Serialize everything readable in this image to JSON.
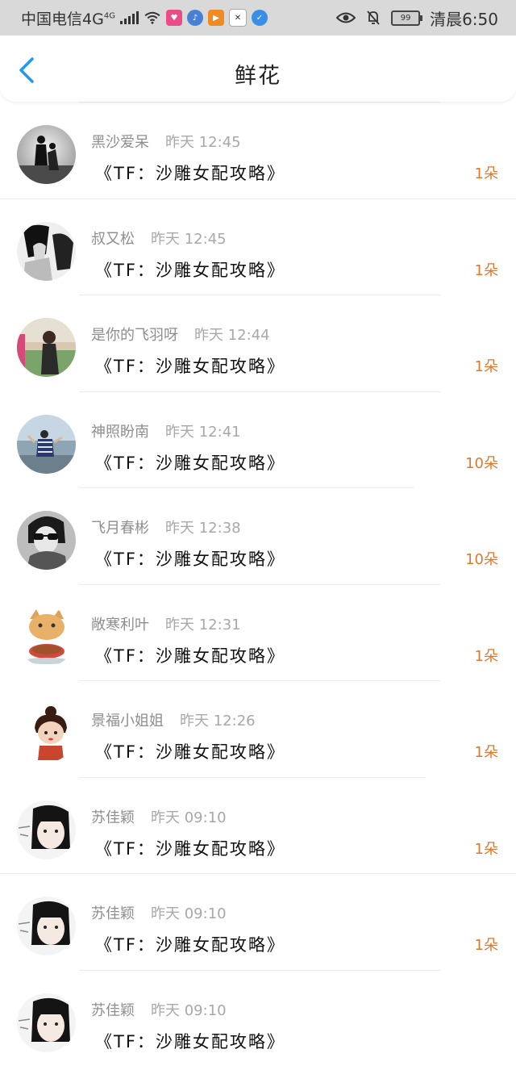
{
  "status_bar": {
    "carrier": "中国电信",
    "network": "4G",
    "network_sup": "4G",
    "battery": "99",
    "time": "清晨6:50",
    "icons": [
      "signal-icon",
      "wifi-icon",
      "app-icon-1",
      "music-app-icon",
      "video-app-icon",
      "app-icon-4",
      "app-icon-5",
      "eye-icon",
      "mute-bell-icon",
      "battery-icon"
    ]
  },
  "header": {
    "title": "鲜花"
  },
  "items": [
    {
      "name": "黑沙爱呆",
      "time": "昨天 12:45",
      "book": "《TF：沙雕女配攻略》",
      "count": "1朵"
    },
    {
      "name": "叔又松",
      "time": "昨天 12:45",
      "book": "《TF：沙雕女配攻略》",
      "count": "1朵"
    },
    {
      "name": "是你的飞羽呀",
      "time": "昨天 12:44",
      "book": "《TF：沙雕女配攻略》",
      "count": "1朵"
    },
    {
      "name": "神照盼南",
      "time": "昨天 12:41",
      "book": "《TF：沙雕女配攻略》",
      "count": "10朵"
    },
    {
      "name": "飞月春彬",
      "time": "昨天 12:38",
      "book": "《TF：沙雕女配攻略》",
      "count": "10朵"
    },
    {
      "name": "敞寒利叶",
      "time": "昨天 12:31",
      "book": "《TF：沙雕女配攻略》",
      "count": "1朵"
    },
    {
      "name": "景福小姐姐",
      "time": "昨天 12:26",
      "book": "《TF：沙雕女配攻略》",
      "count": "1朵"
    },
    {
      "name": "苏佳颖",
      "time": "昨天 09:10",
      "book": "《TF：沙雕女配攻略》",
      "count": "1朵"
    },
    {
      "name": "苏佳颖",
      "time": "昨天 09:10",
      "book": "《TF：沙雕女配攻略》",
      "count": "1朵"
    },
    {
      "name": "苏佳颖",
      "time": "昨天 09:10",
      "book": "《TF：沙雕女配攻略》",
      "count": ""
    }
  ],
  "colors": {
    "accent": "#e0782c",
    "back": "#2196f3"
  }
}
